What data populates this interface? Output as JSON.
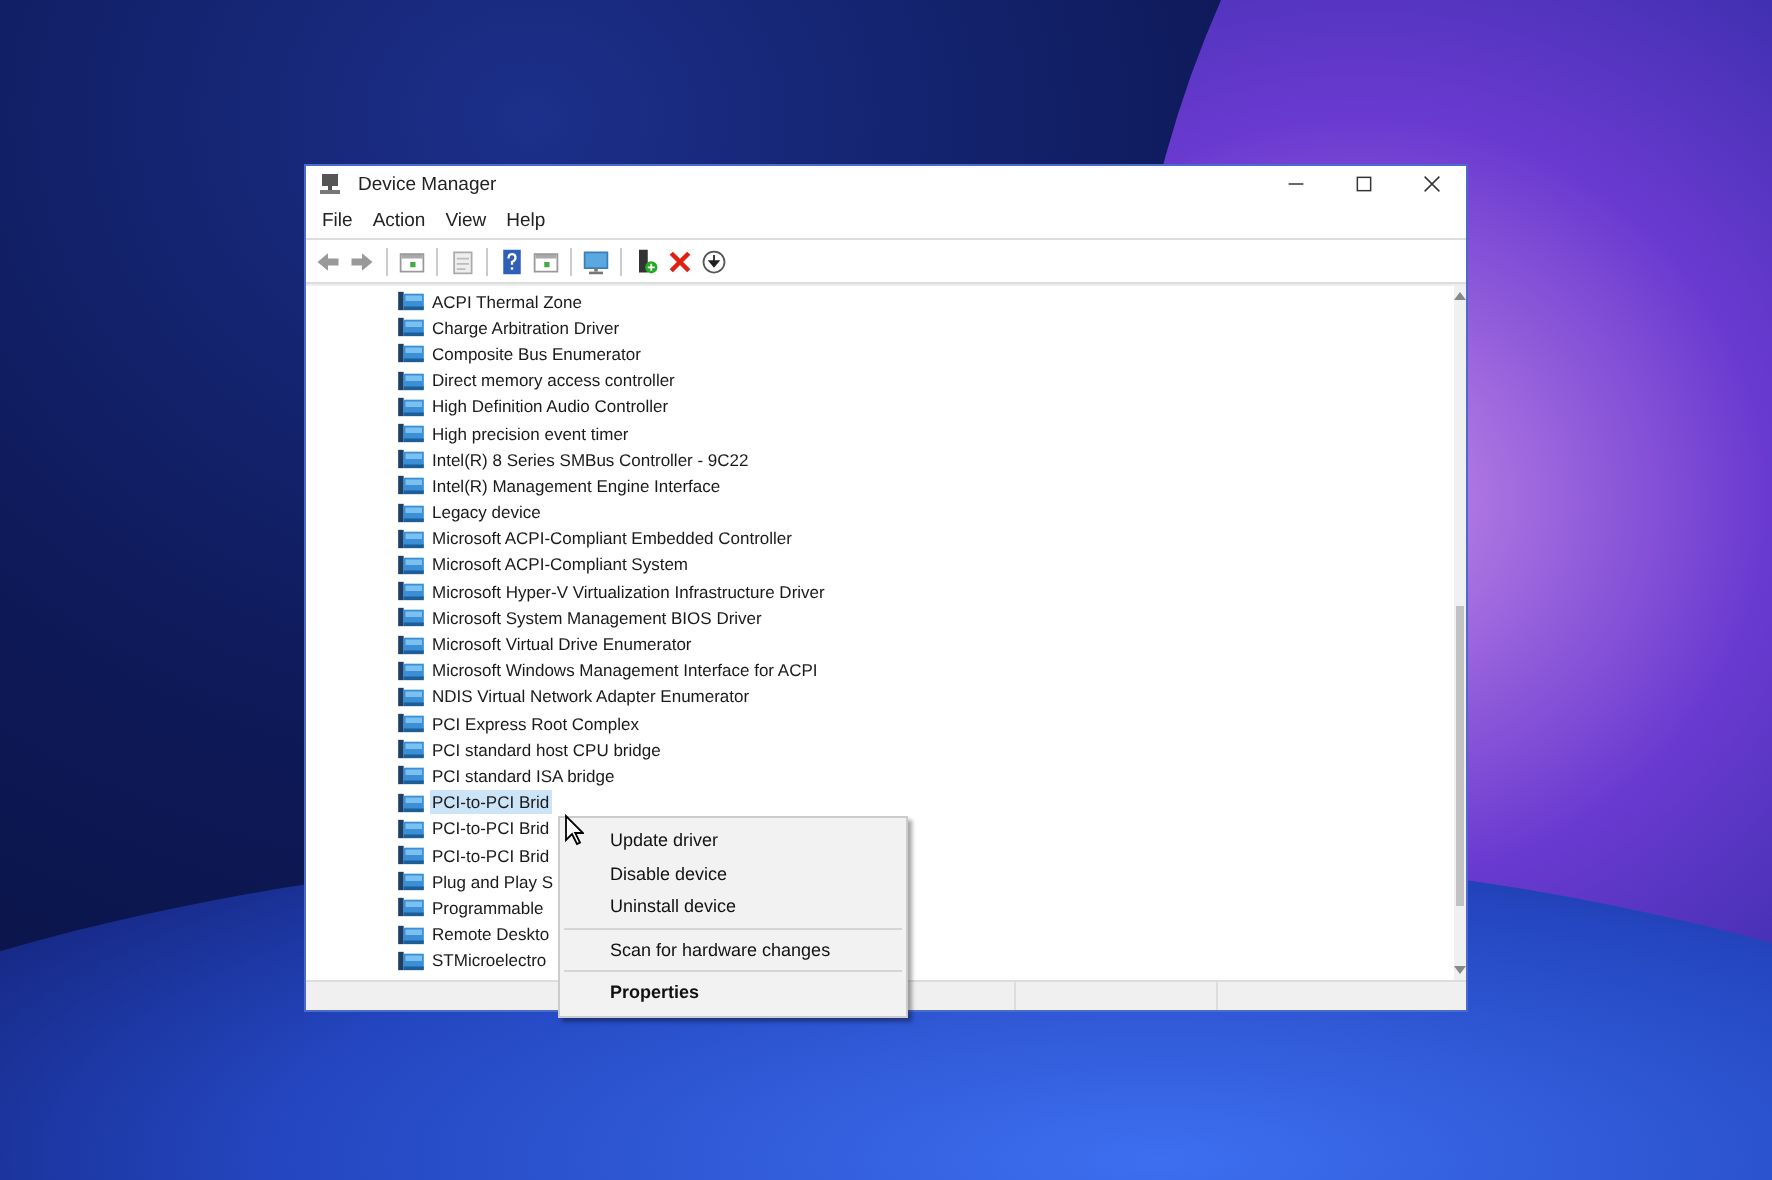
{
  "window": {
    "title": "Device Manager"
  },
  "menu_bar": [
    "File",
    "Action",
    "View",
    "Help"
  ],
  "tree": {
    "rows": [
      {
        "label": "ACPI Thermal Zone",
        "selected": false
      },
      {
        "label": "Charge Arbitration Driver",
        "selected": false
      },
      {
        "label": "Composite Bus Enumerator",
        "selected": false
      },
      {
        "label": "Direct memory access controller",
        "selected": false
      },
      {
        "label": "High Definition Audio Controller",
        "selected": false
      },
      {
        "label": "High precision event timer",
        "selected": false
      },
      {
        "label": "Intel(R) 8 Series SMBus Controller - 9C22",
        "selected": false
      },
      {
        "label": "Intel(R) Management Engine Interface",
        "selected": false
      },
      {
        "label": "Legacy device",
        "selected": false
      },
      {
        "label": "Microsoft ACPI-Compliant Embedded Controller",
        "selected": false
      },
      {
        "label": "Microsoft ACPI-Compliant System",
        "selected": false
      },
      {
        "label": "Microsoft Hyper-V Virtualization Infrastructure Driver",
        "selected": false
      },
      {
        "label": "Microsoft System Management BIOS Driver",
        "selected": false
      },
      {
        "label": "Microsoft Virtual Drive Enumerator",
        "selected": false
      },
      {
        "label": "Microsoft Windows Management Interface for ACPI",
        "selected": false
      },
      {
        "label": "NDIS Virtual Network Adapter Enumerator",
        "selected": false
      },
      {
        "label": "PCI Express Root Complex",
        "selected": false
      },
      {
        "label": "PCI standard host CPU bridge",
        "selected": false
      },
      {
        "label": "PCI standard ISA bridge",
        "selected": false
      },
      {
        "label": "PCI-to-PCI Brid",
        "selected": true
      },
      {
        "label": "PCI-to-PCI Brid",
        "selected": false
      },
      {
        "label": "PCI-to-PCI Brid",
        "selected": false
      },
      {
        "label": "Plug and Play S",
        "selected": false
      },
      {
        "label": "Programmable",
        "selected": false
      },
      {
        "label": "Remote Deskto",
        "selected": false
      },
      {
        "label": "STMicroelectro",
        "selected": false
      }
    ]
  },
  "context_menu": {
    "groups": [
      [
        {
          "label": "Update driver",
          "default": false
        },
        {
          "label": "Disable device",
          "default": false
        },
        {
          "label": "Uninstall device",
          "default": false
        }
      ],
      [
        {
          "label": "Scan for hardware changes",
          "default": false
        }
      ],
      [
        {
          "label": "Properties",
          "default": true
        }
      ]
    ]
  }
}
